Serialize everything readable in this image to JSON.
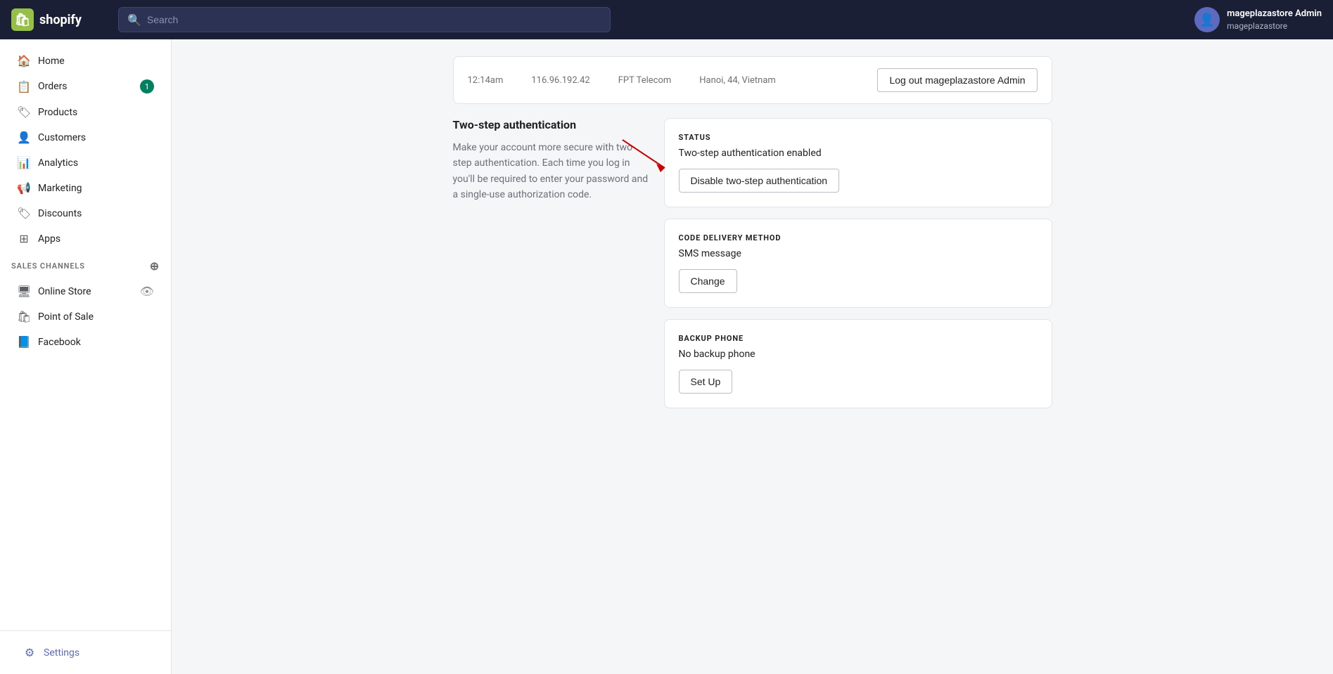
{
  "topnav": {
    "logo_text": "shopify",
    "logo_icon": "🛍",
    "search_placeholder": "Search"
  },
  "user": {
    "name": "mageplazastore Admin",
    "store": "mageplazastore",
    "avatar_icon": "👤"
  },
  "sidebar": {
    "nav_items": [
      {
        "id": "home",
        "label": "Home",
        "icon": "🏠",
        "badge": null
      },
      {
        "id": "orders",
        "label": "Orders",
        "icon": "📋",
        "badge": "1"
      },
      {
        "id": "products",
        "label": "Products",
        "icon": "🏷",
        "badge": null
      },
      {
        "id": "customers",
        "label": "Customers",
        "icon": "👤",
        "badge": null
      },
      {
        "id": "analytics",
        "label": "Analytics",
        "icon": "📊",
        "badge": null
      },
      {
        "id": "marketing",
        "label": "Marketing",
        "icon": "📢",
        "badge": null
      },
      {
        "id": "discounts",
        "label": "Discounts",
        "icon": "🏷",
        "badge": null
      },
      {
        "id": "apps",
        "label": "Apps",
        "icon": "⊞",
        "badge": null
      }
    ],
    "sales_channels_label": "SALES CHANNELS",
    "sales_channels": [
      {
        "id": "online-store",
        "label": "Online Store",
        "icon": "🖥",
        "has_eye": true
      },
      {
        "id": "point-of-sale",
        "label": "Point of Sale",
        "icon": "🛍"
      },
      {
        "id": "facebook",
        "label": "Facebook",
        "icon": "📘"
      }
    ],
    "settings_label": "Settings",
    "settings_icon": "⚙"
  },
  "session": {
    "time": "12:14am",
    "ip": "116.96.192.42",
    "isp": "FPT Telecom",
    "location": "Hanoi, 44, Vietnam",
    "logout_label": "Log out mageplazastore Admin"
  },
  "two_step": {
    "title": "Two-step authentication",
    "description": "Make your account more secure with two-step authentication. Each time you log in you'll be required to enter your password and a single-use authorization code."
  },
  "status_card": {
    "heading": "STATUS",
    "status_text": "Two-step authentication enabled",
    "disable_btn": "Disable two-step authentication"
  },
  "code_delivery_card": {
    "heading": "CODE DELIVERY METHOD",
    "method_text": "SMS message",
    "change_btn": "Change"
  },
  "backup_card": {
    "heading": "BACKUP PHONE",
    "backup_text": "No backup phone",
    "setup_btn": "Set Up"
  }
}
